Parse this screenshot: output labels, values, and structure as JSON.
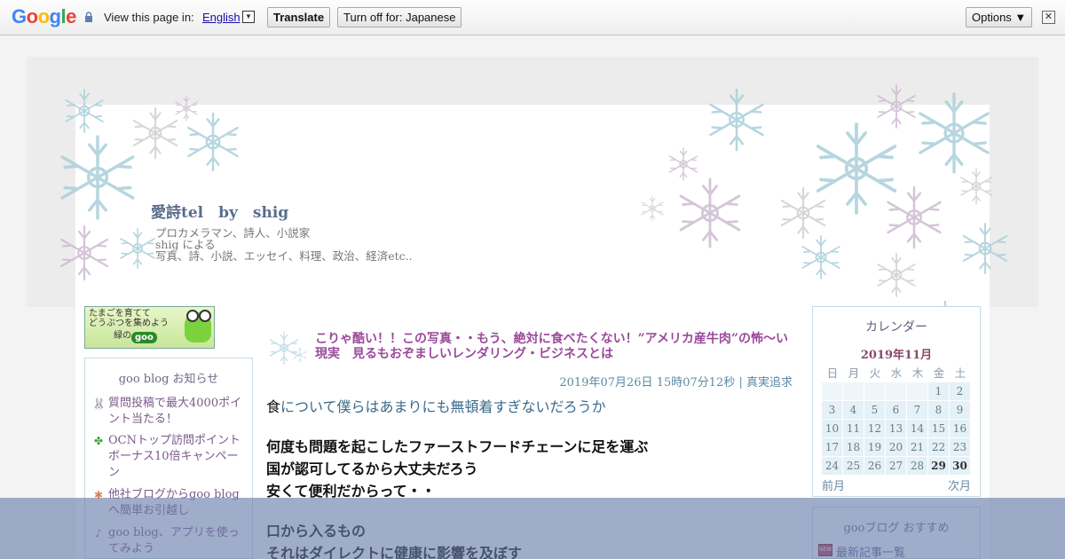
{
  "translate_bar": {
    "logo_letters": [
      "G",
      "o",
      "o",
      "g",
      "l",
      "e"
    ],
    "logo_colors": [
      "#4285f4",
      "#ea4335",
      "#fbbc05",
      "#4285f4",
      "#34a853",
      "#ea4335"
    ],
    "view_text": "View this page in:",
    "language": "English",
    "dropdown_glyph": "▼",
    "translate_button": "Translate",
    "turn_off_button": "Turn off for: Japanese",
    "options_button": "Options ▼",
    "close_glyph": "✕"
  },
  "header": {
    "blog_title": "愛詩tel　by　shig",
    "description_lines": [
      "プロカメラマン、詩人、小説家",
      "shig による",
      "写真、詩、小説、エッセイ、料理、政治、経済etc.."
    ]
  },
  "left_sidebar": {
    "banner_text_lines": [
      "たまごを育てて",
      "どうぶつを集めよう",
      "緑の"
    ],
    "banner_logo": "goo",
    "notice_title": "goo blog お知らせ",
    "notices": [
      {
        "icon": "rabbit-icon",
        "glyph": "🐰",
        "text": "質問投稿で最大4000ポイント当たる！"
      },
      {
        "icon": "clover-icon",
        "glyph": "✤",
        "text": "OCNトップ訪問ポイントボーナス10倍キャンペーン"
      },
      {
        "icon": "gift-icon",
        "glyph": "✱",
        "text": "他社ブログからgoo blogへ簡単お引越し"
      },
      {
        "icon": "music-note-icon",
        "glyph": "♪",
        "text": "goo blog、アプリを使ってみよう"
      }
    ]
  },
  "post": {
    "title": "こりゃ酷い！！この写真・・もう、絶対に食べたくない！”アメリカ産牛肉”の怖～い現実　見るもおぞましいレンダリング・ビジネスとは",
    "datetime": "2019年07月26日 15時07分12秒",
    "separator": " | ",
    "category": "真実追求",
    "lead_first_char": "食",
    "lead_rest": "について僕らはあまりにも無頓着すぎないだろうか",
    "lines": [
      "何度も問題を起こしたファーストフードチェーンに足を運ぶ",
      "国が認可してるから大丈夫だろう",
      "安くて便利だからって・・",
      "口から入るもの",
      "それはダイレクトに健康に影響を及ぼす"
    ]
  },
  "calendar": {
    "title": "カレンダー",
    "month": "2019年11月",
    "weekdays": [
      "日",
      "月",
      "火",
      "水",
      "木",
      "金",
      "土"
    ],
    "weeks": [
      [
        "",
        "",
        "",
        "",
        "",
        "1",
        "2"
      ],
      [
        "3",
        "4",
        "5",
        "6",
        "7",
        "8",
        "9"
      ],
      [
        "10",
        "11",
        "12",
        "13",
        "14",
        "15",
        "16"
      ],
      [
        "17",
        "18",
        "19",
        "20",
        "21",
        "22",
        "23"
      ],
      [
        "24",
        "25",
        "26",
        "27",
        "28",
        "29",
        "30"
      ]
    ],
    "prev": "前月",
    "next": "次月"
  },
  "recommend": {
    "title": "gooブログ おすすめ",
    "icon_text": "NEW",
    "first_item": "最新記事一覧"
  },
  "colors": {
    "accent_purple": "#9a4a9a",
    "link_blue": "#5a8aa4",
    "overlay": "#667aaa"
  }
}
